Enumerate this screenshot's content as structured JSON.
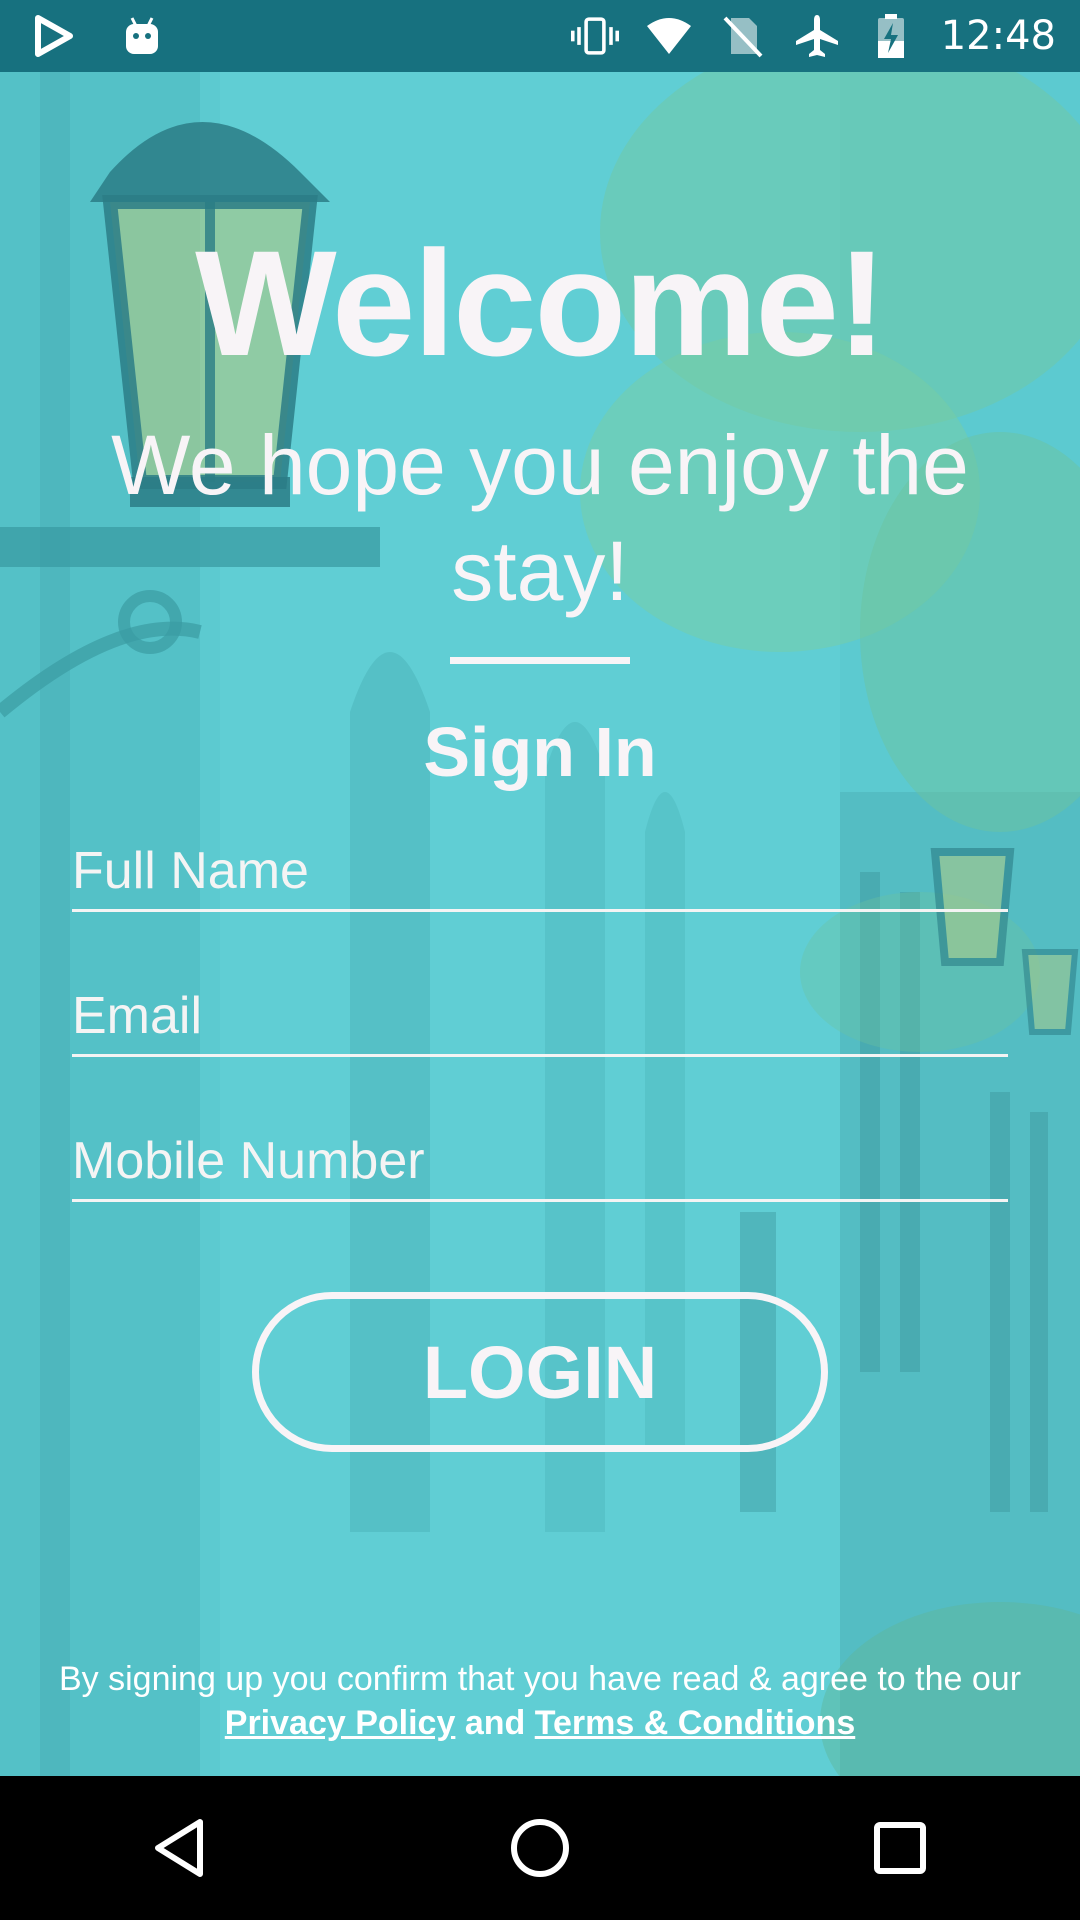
{
  "status_bar": {
    "time": "12:48",
    "left_icons": [
      "play-store-icon",
      "android-icon"
    ],
    "right_icons": [
      "vibrate-icon",
      "wifi-icon",
      "no-sim-icon",
      "airplane-icon",
      "battery-charging-icon"
    ],
    "background_color": "#17717f"
  },
  "main": {
    "title": "Welcome!",
    "subtitle": "We hope you enjoy the stay!",
    "signin_heading": "Sign In",
    "fields": {
      "full_name_placeholder": "Full Name",
      "email_placeholder": "Email",
      "mobile_placeholder": "Mobile Number"
    },
    "login_label": "LOGIN",
    "legal": {
      "text": "By signing up you confirm that you have read & agree to the our",
      "privacy_link": "Privacy Policy",
      "and": "and",
      "terms_link": "Terms & Conditions"
    }
  },
  "nav_bar": {
    "icons": [
      "back-icon",
      "home-icon",
      "recents-icon"
    ]
  },
  "colors": {
    "overlay_teal": "#5bc9cf",
    "text_white": "#f8f4f7"
  }
}
